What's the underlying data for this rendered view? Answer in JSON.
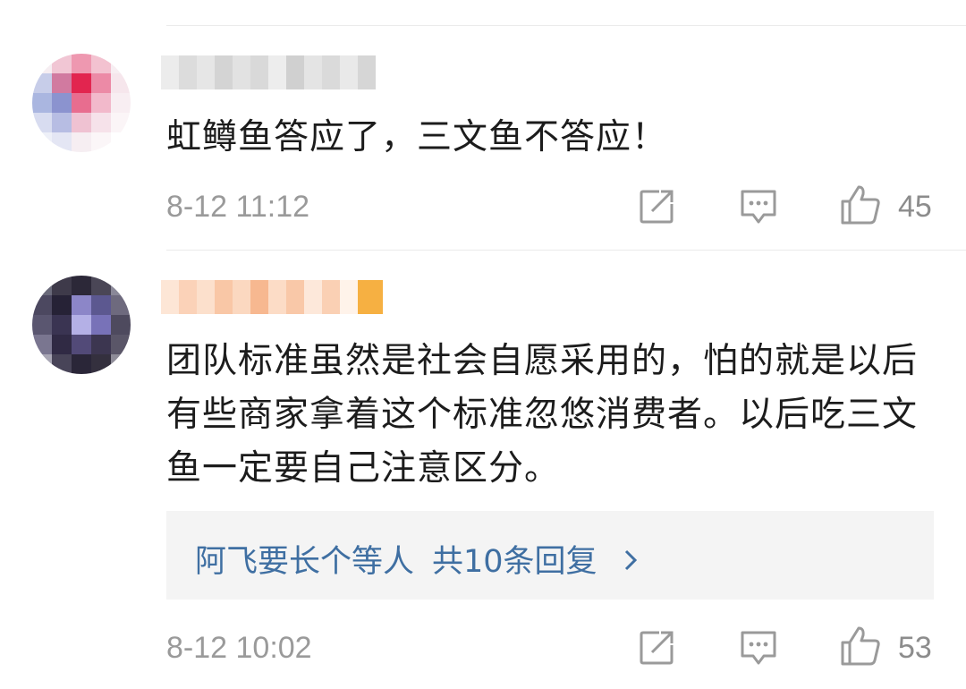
{
  "comments": [
    {
      "username": "",
      "content": "虹鳟鱼答应了，三文鱼不答应！",
      "time": "8-12 11:12",
      "likes": "45",
      "icons": [
        "share-icon",
        "reply-icon",
        "like-icon"
      ]
    },
    {
      "username": "",
      "content": "团队标准虽然是社会自愿采用的，怕的就是以后有些商家拿着这个标准忽悠消费者。以后吃三文鱼一定要自己注意区分。",
      "replies": {
        "user": "阿飞要长个等人",
        "count_label": "共10条回复"
      },
      "time": "8-12 10:02",
      "likes": "53",
      "icons": [
        "share-icon",
        "reply-icon",
        "like-icon"
      ]
    }
  ],
  "colors": {
    "link": "#3f6fa2",
    "meta": "#9a9a9a",
    "text": "#1c1c1c",
    "reply_bg": "#f4f4f4"
  }
}
